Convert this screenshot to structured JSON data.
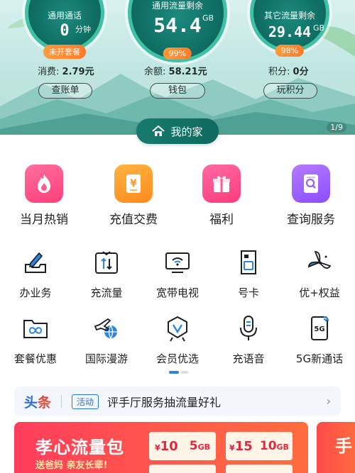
{
  "gauges": [
    {
      "title": "通用通话",
      "value": "0",
      "unit": "分钟",
      "pill": "未开套餐"
    },
    {
      "title": "通用流量剩余",
      "value": "54.4",
      "unit": "GB",
      "pill": "99%"
    },
    {
      "title": "其它流量剩余",
      "value": "29.44",
      "unit": "GB",
      "pill": "98%"
    }
  ],
  "stats": {
    "spend_label": "消费:",
    "spend_value": "2.79元",
    "balance_label": "余额:",
    "balance_value": "58.21元",
    "points_label": "积分:",
    "points_value": "0分"
  },
  "banner_buttons": {
    "bill": "查账单",
    "wallet": "钱包",
    "points": "玩积分"
  },
  "banner_page": "1/9",
  "home_pill": "我的家",
  "big_items": [
    {
      "label": "当月热销",
      "icon": "fire-icon"
    },
    {
      "label": "充值交费",
      "icon": "yen-card-icon"
    },
    {
      "label": "福利",
      "icon": "gift-icon"
    },
    {
      "label": "查询服务",
      "icon": "search-doc-icon"
    }
  ],
  "grid_items": [
    {
      "label": "办业务",
      "icon": "pen-tray-icon"
    },
    {
      "label": "充流量",
      "icon": "data-arrows-icon"
    },
    {
      "label": "宽带电视",
      "icon": "tv-wifi-icon"
    },
    {
      "label": "号卡",
      "icon": "sim-card-icon"
    },
    {
      "label": "优+权益",
      "icon": "pinwheel-icon"
    },
    {
      "label": "套餐优惠",
      "icon": "folder-infinity-icon"
    },
    {
      "label": "国际漫游",
      "icon": "plane-globe-icon"
    },
    {
      "label": "会员优选",
      "icon": "vip-badge-icon"
    },
    {
      "label": "充语音",
      "icon": "microphone-icon"
    },
    {
      "label": "5G新通话",
      "icon": "phone-5g-icon"
    }
  ],
  "headline": {
    "brand_a": "头",
    "brand_b": "条",
    "tag": "活动",
    "text": "评手厅服务抽流量好礼"
  },
  "promo": {
    "title": "孝心流量包",
    "subtitle": "送爸妈 亲友长辈!",
    "coupons": [
      {
        "price_symbol": "¥",
        "price": "10",
        "data": "5",
        "data_unit": "GB"
      },
      {
        "price_symbol": "¥",
        "price": "15",
        "data": "10",
        "data_unit": "GB"
      }
    ],
    "side_text": "手"
  },
  "colors": {
    "teal": "#0f6d62",
    "accent_blue": "#2a74d8",
    "promo_red": "#ff3d5c",
    "pill_orange": "#ff8a33"
  }
}
